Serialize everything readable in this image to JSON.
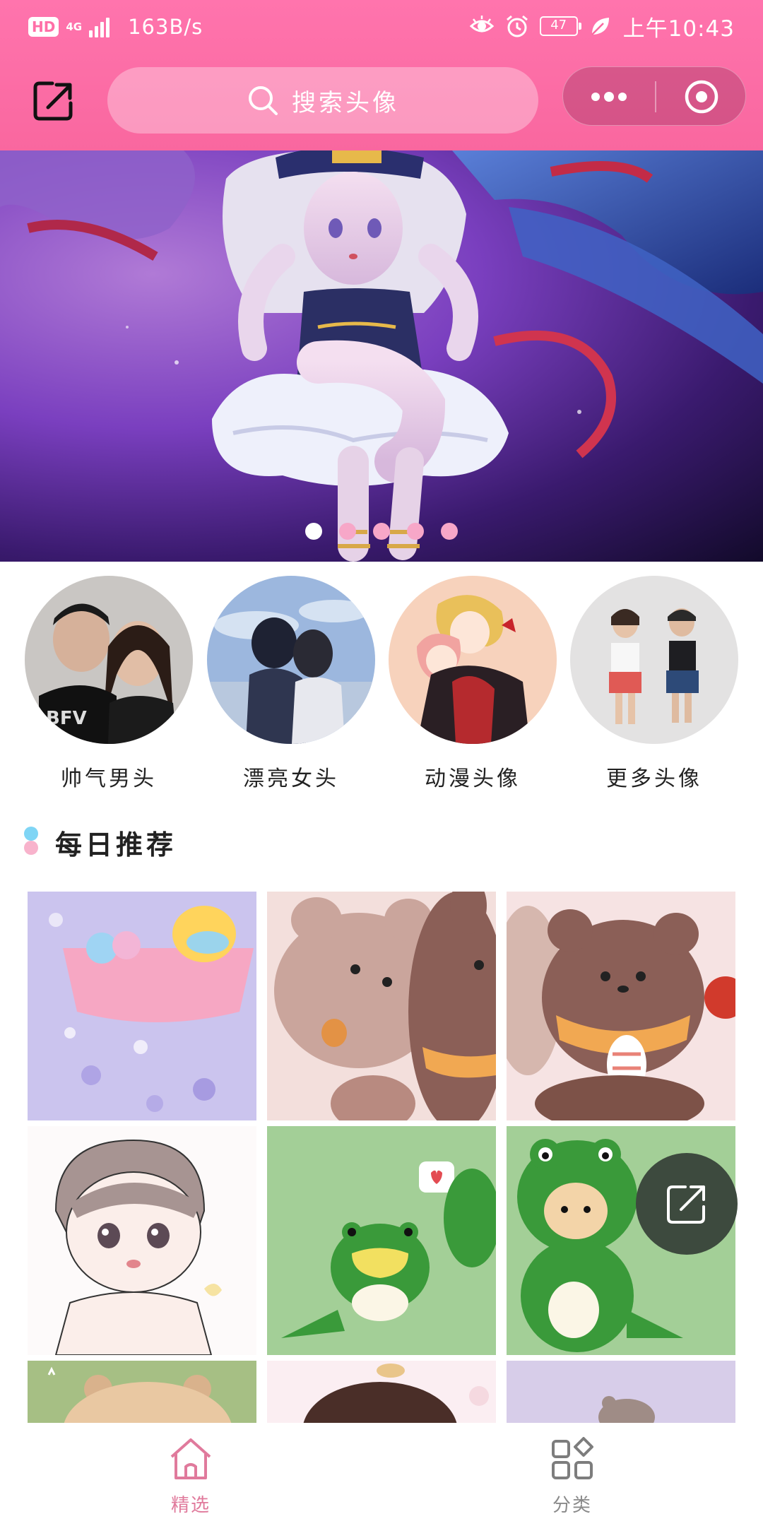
{
  "status_bar": {
    "hd": "HD",
    "network": "4G",
    "speed": "163B/s",
    "battery": "47",
    "time": "上午10:43"
  },
  "header": {
    "search_placeholder": "搜索头像"
  },
  "banner": {
    "slide_count": 5,
    "active_index": 0
  },
  "categories": [
    {
      "label": "帅气男头"
    },
    {
      "label": "漂亮女头"
    },
    {
      "label": "动漫头像"
    },
    {
      "label": "更多头像"
    }
  ],
  "section": {
    "title": "每日推荐"
  },
  "tabbar": {
    "tabs": [
      {
        "label": "精选",
        "active": true
      },
      {
        "label": "分类",
        "active": false
      }
    ]
  },
  "colors": {
    "brand_pink": "#ff6fa7",
    "active_tab": "#e07a9c",
    "inactive_tab": "#8a8a8a"
  }
}
